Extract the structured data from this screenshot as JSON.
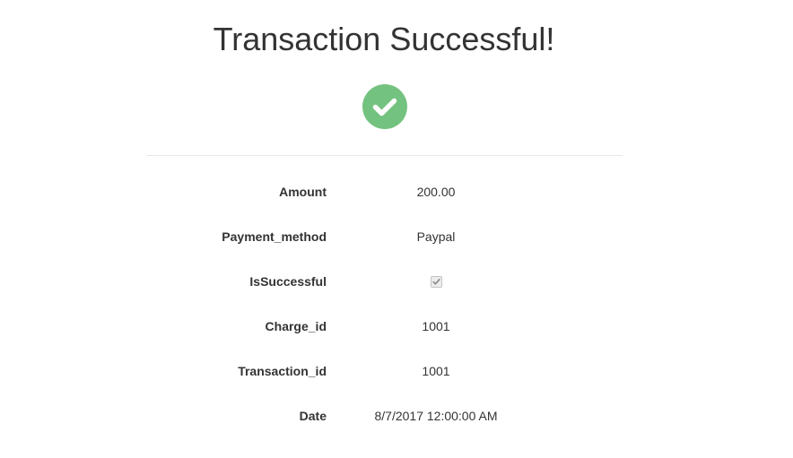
{
  "page": {
    "title": "Transaction Successful!"
  },
  "icons": {
    "success": "check-circle-icon",
    "checkbox": "checkbox-checked"
  },
  "colors": {
    "success_green": "#74c27f",
    "divider": "#e7e7e7",
    "text": "#333333"
  },
  "details": {
    "amount": {
      "label": "Amount",
      "value": "200.00"
    },
    "payment_method": {
      "label": "Payment_method",
      "value": "Paypal"
    },
    "is_successful": {
      "label": "IsSuccessful",
      "checked": true
    },
    "charge_id": {
      "label": "Charge_id",
      "value": "1001"
    },
    "transaction_id": {
      "label": "Transaction_id",
      "value": "1001"
    },
    "date": {
      "label": "Date",
      "value": "8/7/2017 12:00:00 AM"
    }
  }
}
